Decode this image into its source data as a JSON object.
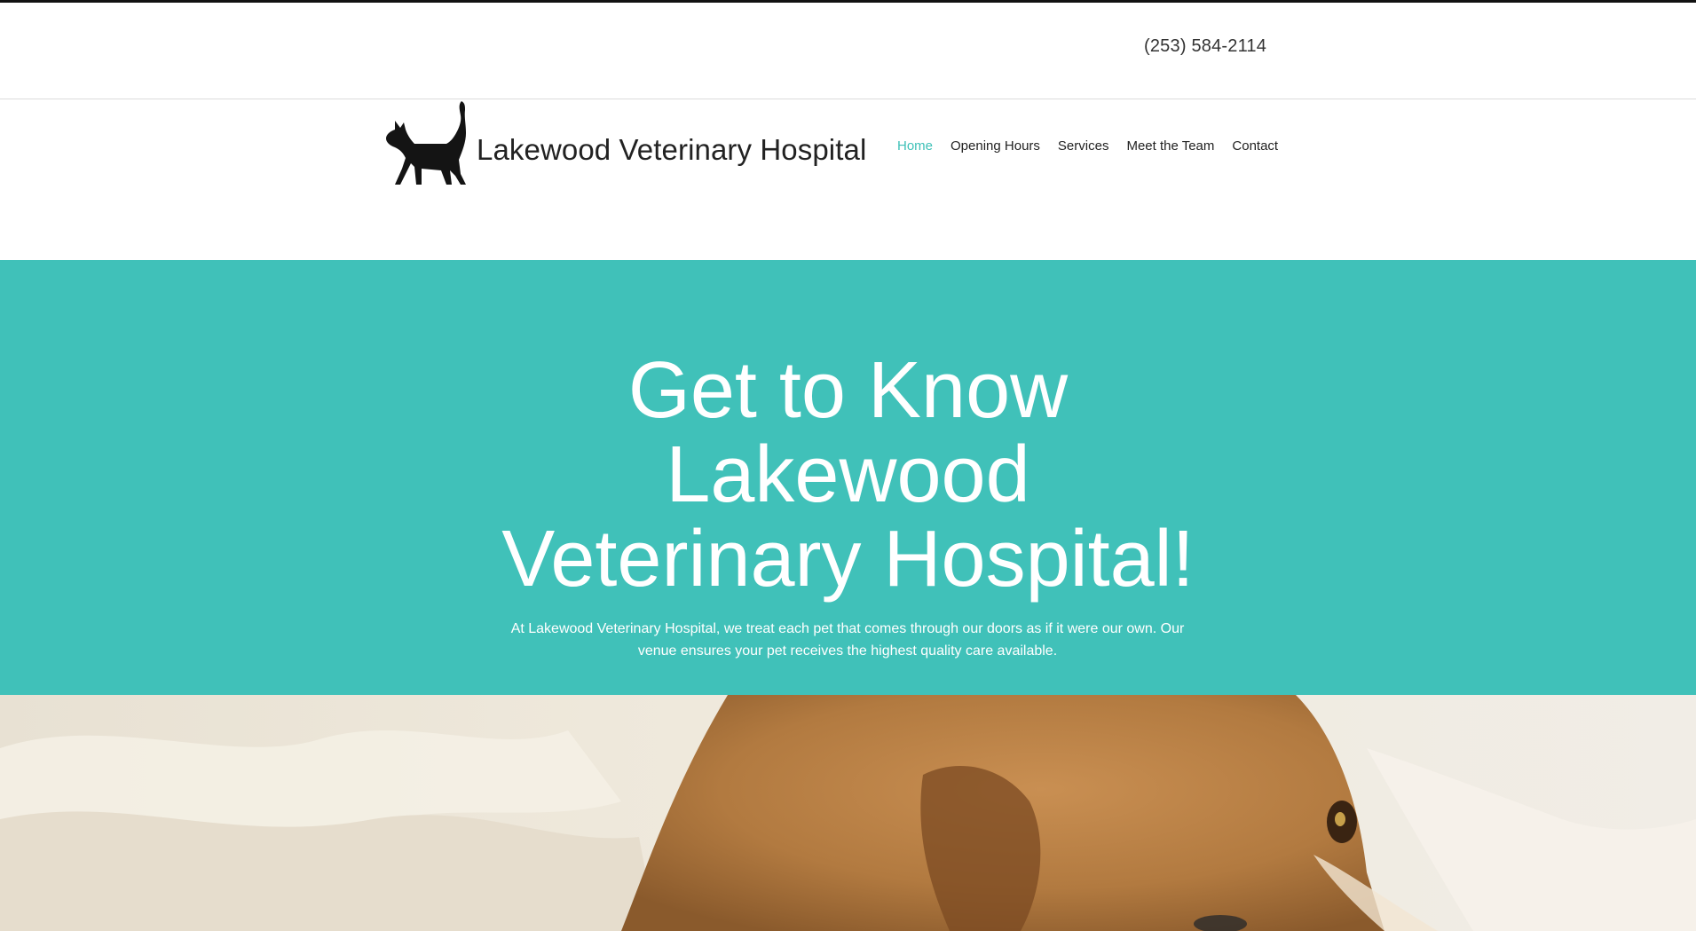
{
  "topbar": {
    "phone": "(253) 584-2114"
  },
  "header": {
    "logo_text": "Lakewood Veterinary Hospital",
    "logo_icon": "cat-silhouette-icon"
  },
  "nav": {
    "items": [
      {
        "label": "Home",
        "active": true
      },
      {
        "label": "Opening Hours",
        "active": false
      },
      {
        "label": "Services",
        "active": false
      },
      {
        "label": "Meet the Team",
        "active": false
      },
      {
        "label": "Contact",
        "active": false
      }
    ]
  },
  "hero": {
    "title_line1": "Get to Know",
    "title_line2": "Lakewood",
    "title_line3": "Veterinary Hospital!",
    "description": "At Lakewood Veterinary Hospital, we treat each pet that comes through our doors as if it were our own. Our venue ensures your pet receives the highest quality care available."
  },
  "colors": {
    "accent": "#40c1b9",
    "nav_active": "#3fc1b8",
    "text_dark": "#222222"
  }
}
